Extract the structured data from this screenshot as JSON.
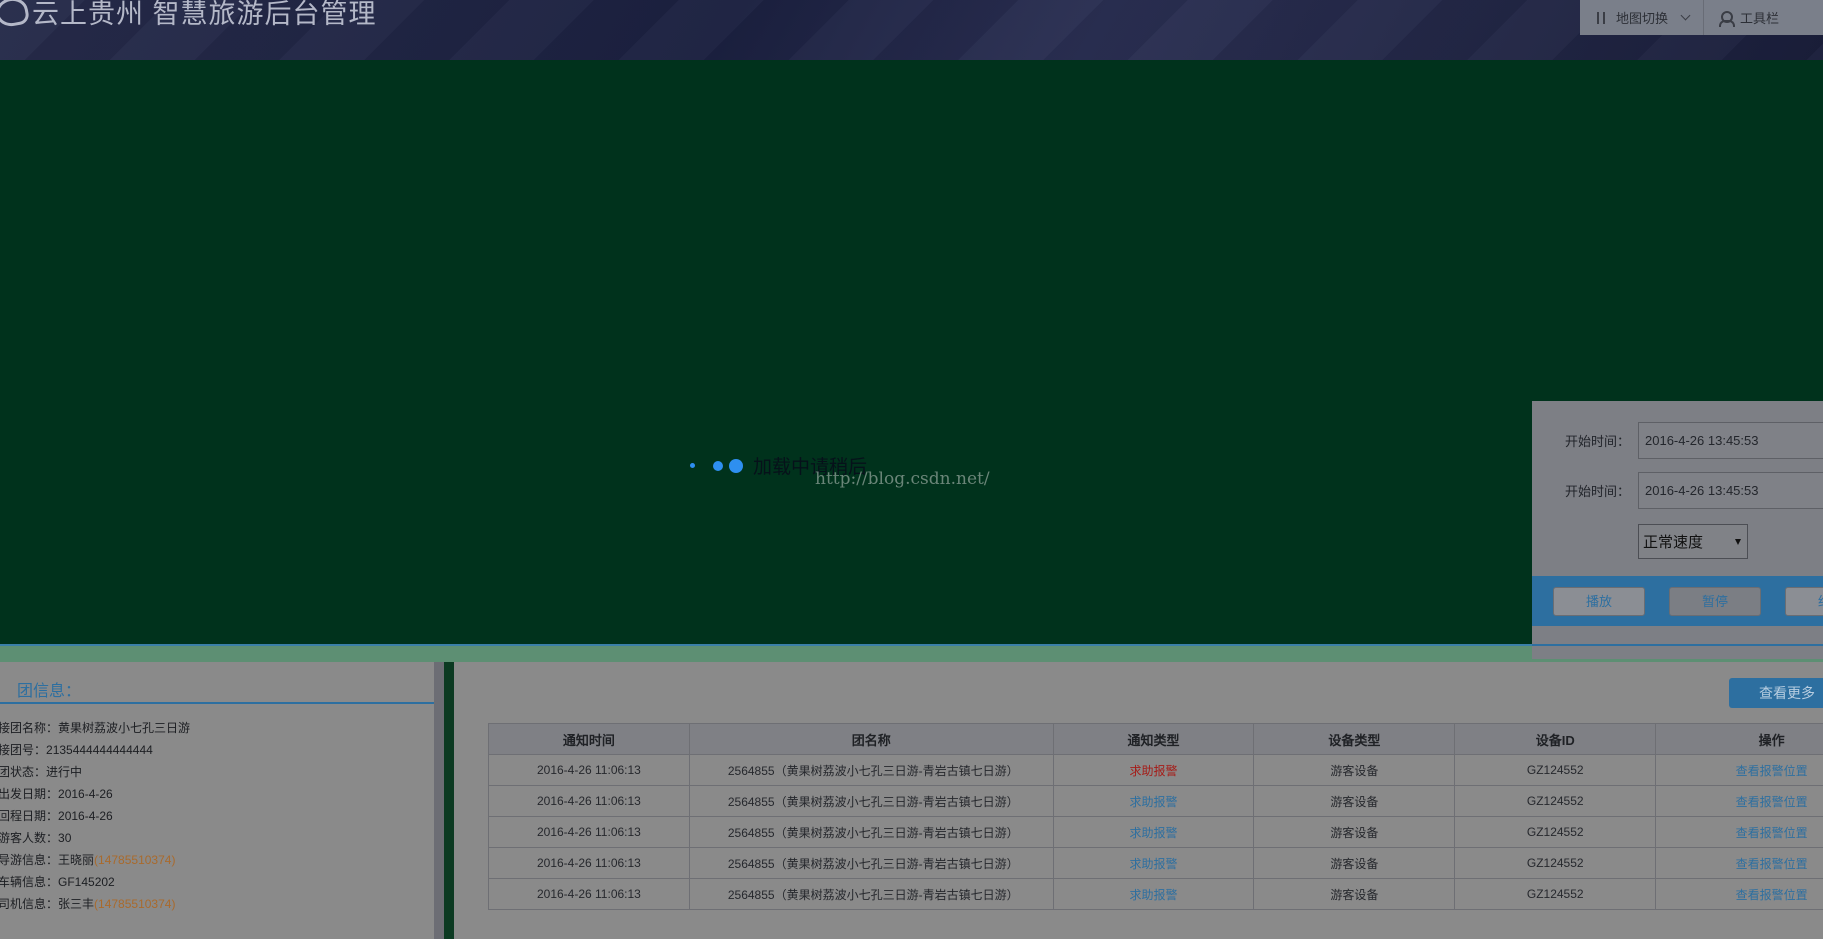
{
  "header": {
    "title": "云上贵州 智慧旅游后台管理",
    "tools": [
      {
        "icon": "swap-icon",
        "label": "地图切换"
      },
      {
        "icon": "user-icon",
        "label": "工具栏"
      }
    ]
  },
  "map": {
    "loading_text": "加载中请稍后",
    "watermark": "http://blog.csdn.net/"
  },
  "playback": {
    "start_label_1": "开始时间：",
    "start_value_1": "2016-4-26 13:45:53",
    "start_label_2": "开始时间：",
    "start_value_2": "2016-4-26 13:45:53",
    "speed": "正常速度",
    "buttons": {
      "play": "播放",
      "pause": "暂停",
      "stop": "结束"
    }
  },
  "group_info": {
    "title": "团信息：",
    "rows": [
      {
        "label": "接团名称：",
        "value": "黄果树荔波小七孔三日游"
      },
      {
        "label": "接团号：",
        "value": "2135444444444444"
      },
      {
        "label": "团状态：",
        "value": "进行中"
      },
      {
        "label": "出发日期：",
        "value": "2016-4-26"
      },
      {
        "label": "回程日期：",
        "value": "2016-4-26"
      },
      {
        "label": "游客人数：",
        "value": "30"
      },
      {
        "label": "导游信息：",
        "value": "王晓丽",
        "phone": "(14785510374)"
      },
      {
        "label": "车辆信息：",
        "value": "GF145202"
      },
      {
        "label": "司机信息：",
        "value": "张三丰",
        "phone": "(14785510374)"
      }
    ]
  },
  "notices": {
    "more_button": "查看更多",
    "columns": [
      "通知时间",
      "团名称",
      "通知类型",
      "设备类型",
      "设备ID",
      "操作"
    ],
    "rows": [
      {
        "time": "2016-4-26 11:06:13",
        "name": "2564855（黄果树荔波小七孔三日游-青岩古镇七日游）",
        "type": "求助报警",
        "device": "游客设备",
        "id": "GZ124552",
        "action": "查看报警位置"
      },
      {
        "time": "2016-4-26 11:06:13",
        "name": "2564855（黄果树荔波小七孔三日游-青岩古镇七日游）",
        "type": "求助报警",
        "device": "游客设备",
        "id": "GZ124552",
        "action": "查看报警位置"
      },
      {
        "time": "2016-4-26 11:06:13",
        "name": "2564855（黄果树荔波小七孔三日游-青岩古镇七日游）",
        "type": "求助报警",
        "device": "游客设备",
        "id": "GZ124552",
        "action": "查看报警位置"
      },
      {
        "time": "2016-4-26 11:06:13",
        "name": "2564855（黄果树荔波小七孔三日游-青岩古镇七日游）",
        "type": "求助报警",
        "device": "游客设备",
        "id": "GZ124552",
        "action": "查看报警位置"
      },
      {
        "time": "2016-4-26 11:06:13",
        "name": "2564855（黄果树荔波小七孔三日游-青岩古镇七日游）",
        "type": "求助报警",
        "device": "游客设备",
        "id": "GZ124552",
        "action": "查看报警位置"
      }
    ]
  },
  "colors": {
    "accent": "#2d6fa0",
    "alarm_red": "#a51c18",
    "map_bg": "#00321c",
    "phone": "#a96a2c"
  }
}
